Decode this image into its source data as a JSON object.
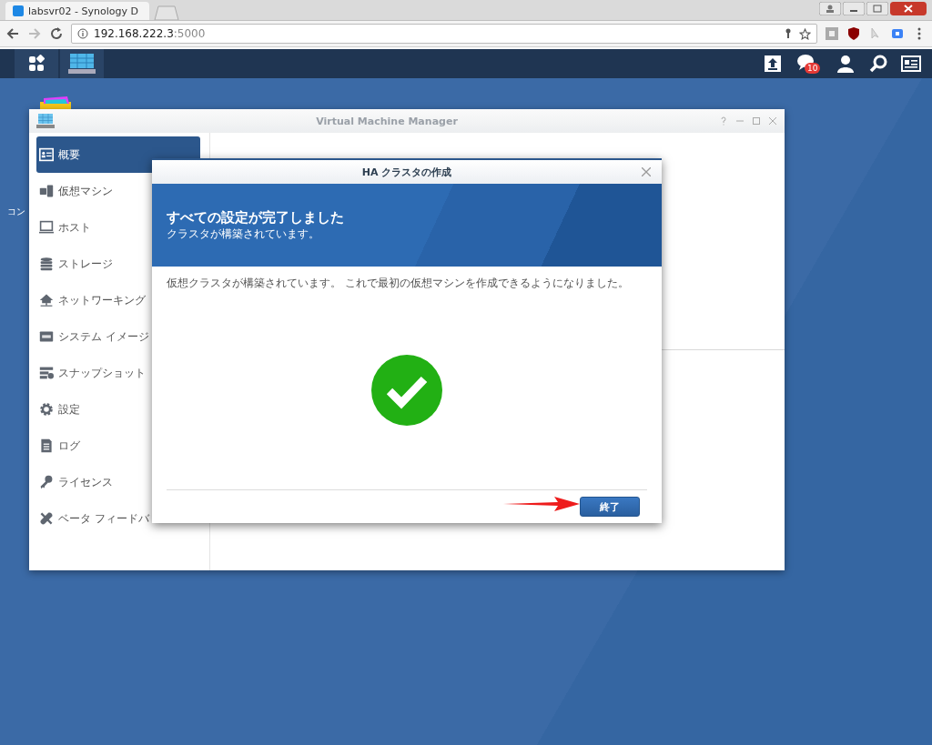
{
  "browser": {
    "tabs": [
      {
        "title": "labsvr02 - Synology D",
        "selected": true
      }
    ],
    "address": {
      "host": "192.168.222.3",
      "port": ":5000"
    }
  },
  "taskbar": {
    "notification_count": "10"
  },
  "desktop_icons": [
    {
      "label": "コン"
    }
  ],
  "app_window": {
    "title": "Virtual Machine Manager",
    "sidebar": [
      {
        "label": "概要",
        "kind": "overview",
        "selected": true
      },
      {
        "label": "仮想マシン",
        "kind": "vm",
        "selected": false
      },
      {
        "label": "ホスト",
        "kind": "host",
        "selected": false
      },
      {
        "label": "ストレージ",
        "kind": "storage",
        "selected": false
      },
      {
        "label": "ネットワーキング",
        "kind": "network",
        "selected": false
      },
      {
        "label": "システム イメージ",
        "kind": "image",
        "selected": false
      },
      {
        "label": "スナップショット",
        "kind": "snapshot",
        "selected": false
      },
      {
        "label": "設定",
        "kind": "settings",
        "selected": false
      },
      {
        "label": "ログ",
        "kind": "log",
        "selected": false
      },
      {
        "label": "ライセンス",
        "kind": "license",
        "selected": false
      },
      {
        "label": "ベータ フィードバ",
        "kind": "feedback",
        "selected": false
      }
    ]
  },
  "dialog": {
    "title": "HA クラスタの作成",
    "banner_title": "すべての設定が完了しました",
    "banner_subtitle": "クラスタが構築されています。",
    "message": "仮想クラスタが構築されています。 これで最初の仮想マシンを作成できるようになりました。",
    "primary_button": "終了"
  }
}
